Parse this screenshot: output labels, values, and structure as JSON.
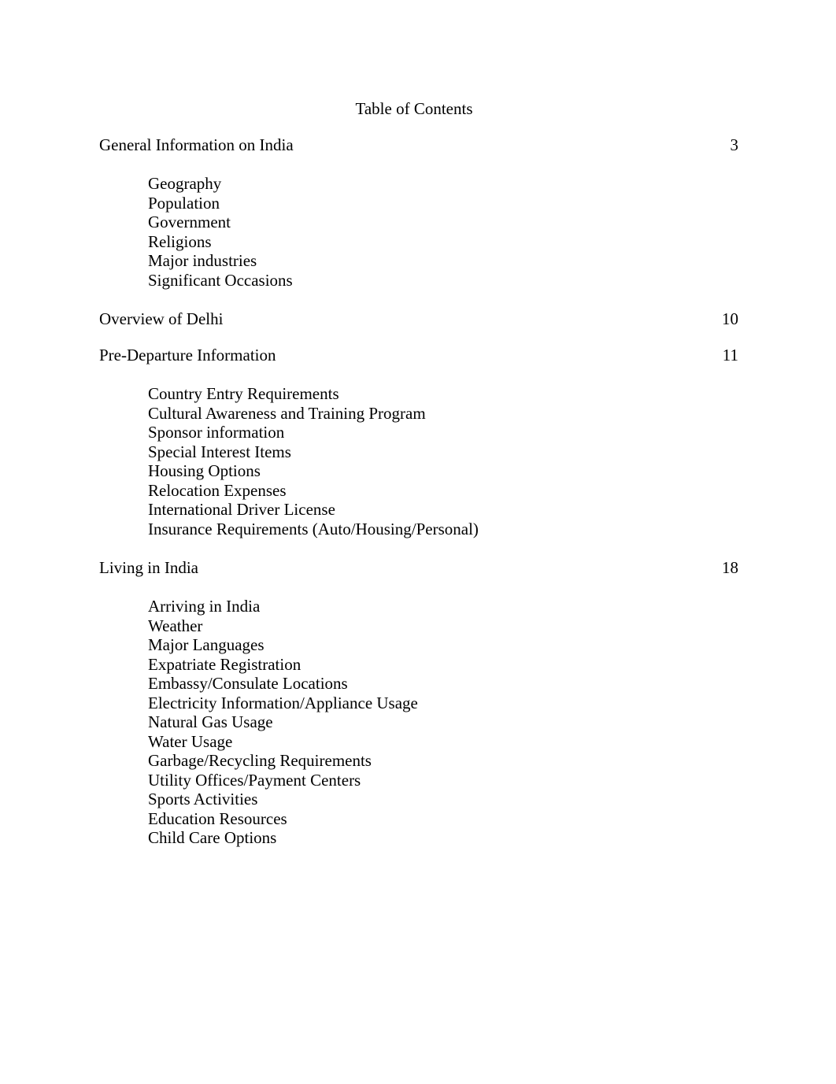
{
  "document": {
    "title": "Table of Contents"
  },
  "toc": {
    "sections": [
      {
        "title": "General Information on India",
        "page": "3",
        "subitems": [
          "Geography",
          "Population",
          "Government",
          "Religions",
          "Major industries",
          "Significant Occasions"
        ]
      },
      {
        "title": "Overview of Delhi",
        "page": "10",
        "subitems": []
      },
      {
        "title": "Pre-Departure Information",
        "page": "11",
        "subitems": [
          "Country Entry Requirements",
          "Cultural Awareness and Training Program",
          "Sponsor information",
          "Special Interest Items",
          "Housing Options",
          "Relocation Expenses",
          "International Driver License",
          "Insurance Requirements (Auto/Housing/Personal)"
        ]
      },
      {
        "title": "Living in India",
        "page": "18",
        "subitems": [
          "Arriving in India",
          "Weather",
          "Major Languages",
          "Expatriate Registration",
          "Embassy/Consulate Locations",
          "Electricity Information/Appliance Usage",
          "Natural Gas Usage",
          "Water Usage",
          "Garbage/Recycling Requirements",
          "Utility Offices/Payment Centers",
          "Sports Activities",
          "Education Resources",
          "Child Care Options"
        ]
      }
    ]
  }
}
